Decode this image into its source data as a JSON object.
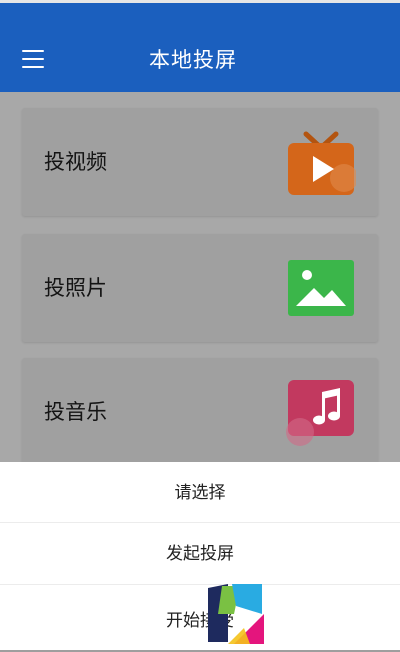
{
  "header": {
    "title": "本地投屏",
    "menu_icon": "hamburger-menu-icon",
    "background": "#1b5fbe"
  },
  "cards": [
    {
      "label": "投视频",
      "icon": "tv-play-icon",
      "icon_color": "#d4661a"
    },
    {
      "label": "投照片",
      "icon": "image-mountain-icon",
      "icon_color": "#3bb64a"
    },
    {
      "label": "投音乐",
      "icon": "music-note-icon",
      "icon_color": "#c2395f"
    }
  ],
  "sheet": {
    "title": "请选择",
    "options": [
      "发起投屏",
      "开始接受"
    ]
  },
  "watermark": {
    "icon": "watermark-logo-icon"
  }
}
